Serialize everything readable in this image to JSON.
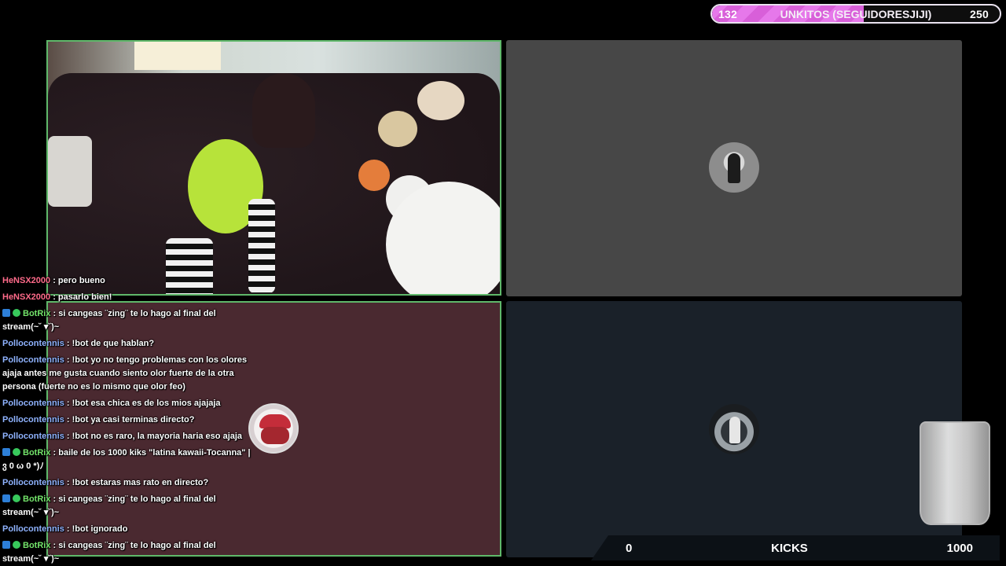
{
  "goal": {
    "current": "132",
    "title": "UNKITOS (SEGUIDORESJIJI)",
    "target": "250",
    "progress": 0.528,
    "fill_color": "#e678ea"
  },
  "kicks": {
    "current": "0",
    "label": "KICKS",
    "target": "1000"
  },
  "chat": {
    "messages": [
      {
        "user": "HeNSX2000",
        "text": " : pero bueno",
        "badges": false,
        "color": "pink"
      },
      {
        "user": "HeNSX2000",
        "text": " : pasarlo bien!",
        "badges": false,
        "color": "pink"
      },
      {
        "user": "BotRix",
        "text": " : si cangeas ¨zing¨ te lo hago al final del stream(~˘ ▾˘)~",
        "badges": true,
        "color": "green"
      },
      {
        "user": "Pollocontennis",
        "text": " : !bot de que hablan?",
        "badges": false,
        "color": "blue"
      },
      {
        "user": "Pollocontennis",
        "text": " : !bot yo no tengo problemas con los olores ajaja antes me gusta cuando siento olor fuerte de la otra persona (fuerte no es lo mismo que olor feo)",
        "badges": false,
        "color": "blue"
      },
      {
        "user": "Pollocontennis",
        "text": " : !bot esa chica es de los mios ajajaja",
        "badges": false,
        "color": "blue"
      },
      {
        "user": "Pollocontennis",
        "text": " : !bot ya casi terminas directo?",
        "badges": false,
        "color": "blue"
      },
      {
        "user": "Pollocontennis",
        "text": " : !bot no es raro, la mayoria haria eso ajaja",
        "badges": false,
        "color": "blue"
      },
      {
        "user": "BotRix",
        "text": " : baile de los 1000 kiks \"latina kawaii-Tocanna\" |ვ 0 ω 0 *)ﾉ",
        "badges": true,
        "color": "green"
      },
      {
        "user": "Pollocontennis",
        "text": " : !bot estaras mas rato en directo?",
        "badges": false,
        "color": "blue"
      },
      {
        "user": "BotRix",
        "text": " : si cangeas ¨zing¨ te lo hago al final del stream(~˘ ▾˘)~",
        "badges": true,
        "color": "green"
      },
      {
        "user": "Pollocontennis",
        "text": " : !bot ignorado",
        "badges": false,
        "color": "blue"
      },
      {
        "user": "BotRix",
        "text": " : si cangeas ¨zing¨ te lo hago al final del stream(~˘ ▾˘)~",
        "badges": true,
        "color": "green"
      }
    ]
  },
  "icons": {
    "bot_badge": "bot-badge-icon",
    "verified_badge": "check-badge-icon"
  }
}
